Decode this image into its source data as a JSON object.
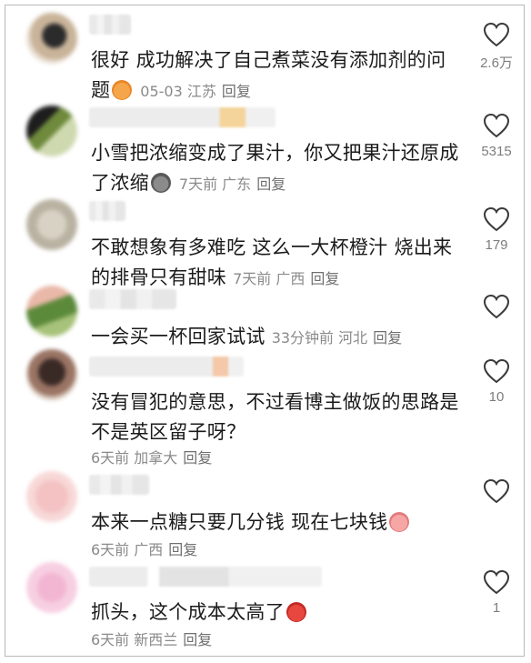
{
  "comments": [
    {
      "text": "很好 成功解决了自己煮菜没有添加剂的问题",
      "emoji": "grinning-mango-emoji",
      "time": "05-03",
      "location": "江苏",
      "reply": "回复",
      "likes": "2.6万"
    },
    {
      "text": "小雪把浓缩变成了果汁，你又把果汁还原成了浓缩",
      "emoji": "cat-emoji",
      "time": "7天前",
      "location": "广东",
      "reply": "回复",
      "likes": "5315"
    },
    {
      "text": "不敢想象有多难吃 这么一大杯橙汁 烧出来的排骨只有甜味",
      "emoji": "",
      "time": "7天前",
      "location": "广西",
      "reply": "回复",
      "likes": "179"
    },
    {
      "text": "一会买一杯回家试试",
      "emoji": "",
      "time": "33分钟前",
      "location": "河北",
      "reply": "回复",
      "likes": ""
    },
    {
      "text": "没有冒犯的意思，不过看博主做饭的思路是不是英区留子呀？",
      "emoji": "",
      "time": "6天前",
      "location": "加拿大",
      "reply": "回复",
      "likes": "10"
    },
    {
      "text": "本来一点糖只要几分钱 现在七块钱",
      "emoji": "surprised-pig-emoji",
      "time": "6天前",
      "location": "广西",
      "reply": "回复",
      "likes": ""
    },
    {
      "text": "抓头，这个成本太高了",
      "emoji": "angry-devil-emoji",
      "time": "6天前",
      "location": "新西兰",
      "reply": "回复",
      "likes": "1"
    }
  ]
}
